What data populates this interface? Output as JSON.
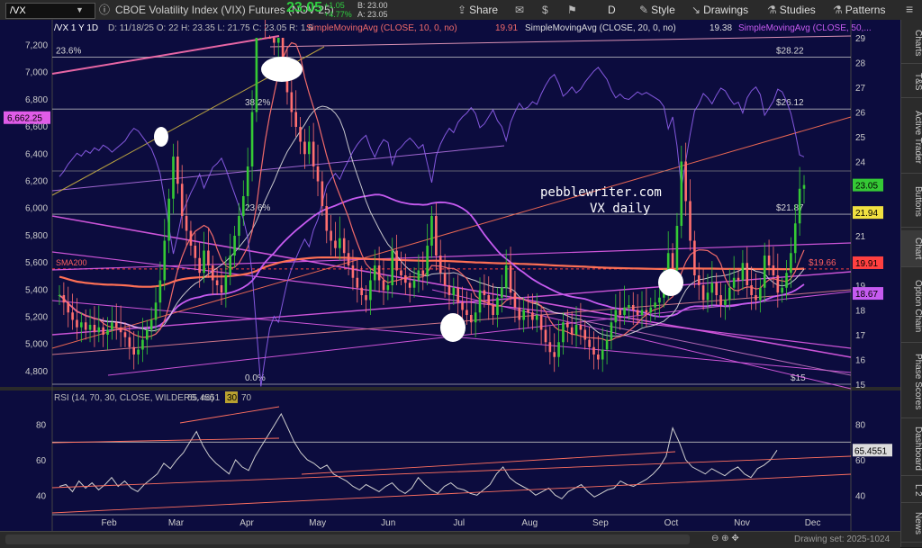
{
  "toolbar": {
    "symbol": "/VX",
    "description": "CBOE Volatility Index (VIX) Futures (NOV 25)",
    "last": "23.05",
    "change": "+1.05",
    "change_pct": "+4.77%",
    "bid": "B: 23.00",
    "ask": "A: 23.05",
    "share_label": "Share",
    "period_label": "D",
    "style_label": "Style",
    "drawings_label": "Drawings",
    "studies_label": "Studies",
    "patterns_label": "Patterns",
    "icons": [
      "share-icon",
      "envelope-icon",
      "dollar-icon",
      "flag-icon",
      "style-icon",
      "drawings-icon",
      "studies-icon",
      "patterns-icon",
      "menu-icon"
    ]
  },
  "side_tabs": [
    "Charts",
    "T&S",
    "Active Trader",
    "Buttons",
    "Chart",
    "Option Chain",
    "Phase Scores",
    "Dashboard",
    "L 2",
    "News"
  ],
  "bottom_bar": {
    "drawing_set": "Drawing set: 2025-1024"
  },
  "colors": {
    "background": "#0c0c3e",
    "up_candle": "#35c935",
    "down_candle": "#ff6f6f",
    "sma10": "#f06a6a",
    "sma20": "#dcdcdc",
    "sma50": "#c65bf0",
    "sma200": "#ff7055",
    "trend_magenta": "#e05ce8",
    "spx_overlay": "#9160f0"
  },
  "chart_data": [
    {
      "type": "candlestick",
      "header": "/VX 1 Y 1D",
      "ohlc_label": "D: 11/18/25  O: 22  H: 23.35  L: 21.75  C: 23.05  R: 1.6",
      "studies": [
        {
          "name": "SimpleMovingAvg (CLOSE, 10, 0, no)",
          "value": "19.91",
          "color": "#f06a6a"
        },
        {
          "name": "SimpleMovingAvg (CLOSE, 20, 0, no)",
          "value": "19.38",
          "color": "#dcdcdc"
        },
        {
          "name": "SimpleMovingAvg (CLOSE, 50,...",
          "value": "",
          "color": "#c65bf0"
        }
      ],
      "x_ticks": [
        "Feb",
        "Mar",
        "Apr",
        "May",
        "Jun",
        "Jul",
        "Aug",
        "Sep",
        "Oct",
        "Nov",
        "Dec"
      ],
      "left_axis_ticks": [
        "7,200",
        "7,000",
        "6,800",
        "6,600",
        "6,400",
        "6,200",
        "6,000",
        "5,800",
        "5,600",
        "5,400",
        "5,200",
        "5,000",
        "4,800"
      ],
      "right_axis_ticks": [
        "29",
        "28",
        "27",
        "26",
        "25",
        "24",
        "23",
        "22",
        "21",
        "20",
        "19",
        "18",
        "17",
        "16",
        "15"
      ],
      "price_labels": [
        {
          "text": "23.05",
          "value": 23.05,
          "color": "#35c935"
        },
        {
          "text": "21.94",
          "value": 21.94,
          "color": "#f0e040"
        },
        {
          "text": "19.91",
          "value": 19.91,
          "color": "#ff4040"
        },
        {
          "text": "18.67",
          "value": 18.67,
          "color": "#c65bf0"
        }
      ],
      "left_price_label": {
        "text": "6,662.25",
        "value": 6662.25
      },
      "fib_levels": [
        {
          "label": "23.6%",
          "value": 28.22,
          "price_text": "$28.22"
        },
        {
          "label": "38.2%",
          "value": 26.12,
          "price_text": "$26.12"
        },
        {
          "label": "23.6%",
          "value": 21.87,
          "price_text": "$21.87"
        },
        {
          "label": "0.0%",
          "value": 15.0,
          "price_text": "$15"
        }
      ],
      "sma200": {
        "label": "SMA200",
        "value": 19.66,
        "price_text": "$19.66"
      },
      "annotation": [
        "pebblewriter.com",
        "VX daily"
      ],
      "ylim_right": [
        15,
        29
      ],
      "ylim_left": [
        4700,
        7250
      ],
      "series": [
        {
          "name": "VX",
          "values": [
            18.6,
            18.3,
            17.9,
            17.6,
            17.3,
            17.5,
            17.2,
            17.4,
            17.1,
            17.3,
            17.0,
            17.2,
            17.5,
            17.3,
            17.1,
            16.9,
            16.5,
            16.2,
            16.4,
            16.8,
            17.2,
            17.6,
            18.3,
            19.2,
            20.8,
            22.5,
            24.2,
            23.1,
            21.8,
            21.2,
            20.6,
            20.1,
            19.5,
            20.4,
            19.8,
            19.2,
            19.0,
            18.7,
            19.4,
            20.2,
            21.0,
            21.8,
            22.6,
            23.8,
            26.0,
            29.5,
            33.0,
            31.2,
            29.5,
            28.8,
            29.2,
            28.0,
            26.8,
            26.0,
            25.4,
            24.8,
            24.3,
            24.8,
            23.8,
            23.2,
            22.2,
            21.2,
            20.8,
            20.5,
            20.9,
            20.3,
            19.8,
            19.3,
            18.9,
            18.6,
            18.4,
            19.2,
            19.8,
            19.2,
            18.8,
            19.0,
            20.4,
            19.6,
            19.4,
            19.1,
            18.9,
            19.2,
            19.6,
            19.4,
            20.6,
            21.8,
            20.2,
            19.5,
            19.0,
            18.6,
            18.9,
            18.3,
            18.0,
            17.8,
            17.5,
            17.9,
            18.8,
            18.6,
            18.2,
            17.8,
            18.5,
            18.9,
            19.8,
            18.7,
            18.1,
            17.6,
            18.0,
            17.9,
            17.6,
            17.8,
            17.2,
            16.7,
            16.3,
            16.1,
            16.7,
            17.5,
            17.3,
            17.0,
            17.4,
            17.2,
            16.8,
            16.5,
            16.2,
            16.0,
            16.4,
            16.8,
            17.5,
            18.0,
            17.8,
            18.1,
            18.2,
            18.0,
            17.8,
            18.0,
            17.9,
            18.1,
            18.3,
            18.5,
            18.9,
            20.3,
            19.6,
            21.4,
            24.0,
            22.4,
            20.8,
            19.4,
            19.0,
            18.4,
            18.7,
            19.1,
            18.6,
            18.2,
            18.4,
            18.9,
            19.3,
            19.2,
            19.9,
            19.0,
            18.6,
            18.4,
            18.9,
            20.2,
            19.8,
            19.4,
            18.7,
            18.9,
            19.5,
            20.3,
            21.5,
            22.9,
            23.05
          ]
        },
        {
          "name": "RSI (14, 70, 30, CLOSE, WILDERS, no)",
          "axis": "rsi",
          "values": [
            45,
            46,
            42,
            48,
            44,
            47,
            43,
            46,
            50,
            45,
            48,
            44,
            42,
            46,
            49,
            52,
            58,
            55,
            60,
            64,
            70,
            76,
            68,
            62,
            58,
            55,
            52,
            60,
            56,
            54,
            62,
            68,
            74,
            80,
            86,
            78,
            70,
            64,
            60,
            58,
            55,
            57,
            52,
            50,
            48,
            45,
            43,
            46,
            44,
            42,
            45,
            47,
            43,
            41,
            44,
            50,
            46,
            43,
            41,
            45,
            47,
            44,
            43,
            41,
            40,
            43,
            46,
            52,
            56,
            50,
            47,
            45,
            43,
            40,
            42,
            44,
            40,
            38,
            42,
            44,
            46,
            42,
            39,
            41,
            43,
            44,
            48,
            46,
            45,
            47,
            49,
            52,
            56,
            62,
            78,
            70,
            60,
            56,
            54,
            52,
            55,
            53,
            51,
            54,
            56,
            52,
            50,
            55,
            57,
            60,
            65.4551
          ]
        }
      ]
    },
    {
      "type": "line",
      "header": "RSI (14, 70, 30, CLOSE, WILDERS, no)",
      "value_label": "65.4551",
      "params": [
        "30",
        "70"
      ],
      "y_ticks": [
        "80",
        "60",
        "40"
      ],
      "ylim": [
        30,
        90
      ],
      "series": [
        {
          "name": "RSI",
          "values": [
            45,
            46,
            42,
            48,
            44,
            47,
            43,
            46,
            50,
            45,
            48,
            44,
            42,
            46,
            49,
            52,
            58,
            55,
            60,
            64,
            70,
            76,
            68,
            62,
            58,
            55,
            52,
            60,
            56,
            54,
            62,
            68,
            74,
            80,
            86,
            78,
            70,
            64,
            60,
            58,
            55,
            57,
            52,
            50,
            48,
            45,
            43,
            46,
            44,
            42,
            45,
            47,
            43,
            41,
            44,
            50,
            46,
            43,
            41,
            45,
            47,
            44,
            43,
            41,
            40,
            43,
            46,
            52,
            56,
            50,
            47,
            45,
            43,
            40,
            42,
            44,
            40,
            38,
            42,
            44,
            46,
            42,
            39,
            41,
            43,
            44,
            48,
            46,
            45,
            47,
            49,
            52,
            56,
            62,
            78,
            70,
            60,
            56,
            54,
            52,
            55,
            53,
            51,
            54,
            56,
            52,
            50,
            55,
            57,
            60,
            65.4551
          ]
        }
      ]
    }
  ]
}
